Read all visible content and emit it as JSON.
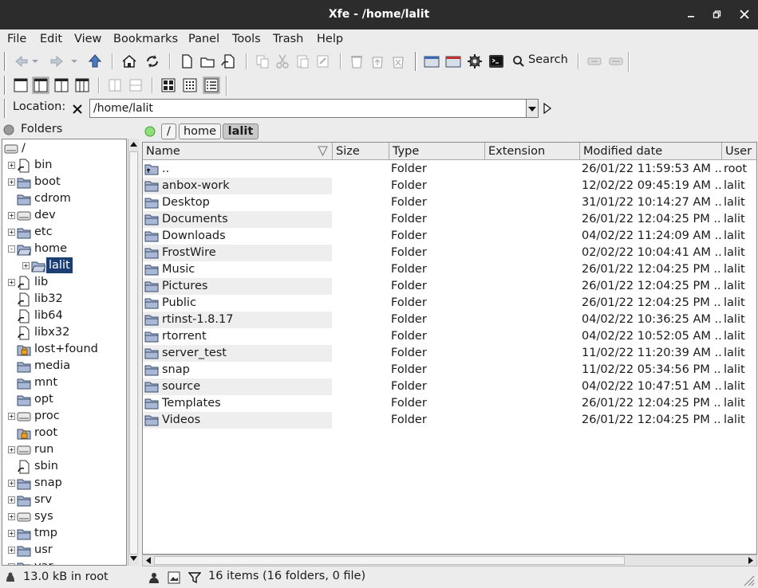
{
  "window": {
    "title": "Xfe - /home/lalit"
  },
  "menu": [
    "File",
    "Edit",
    "View",
    "Bookmarks",
    "Panel",
    "Tools",
    "Trash",
    "Help"
  ],
  "toolbar": {
    "search_label": "Search"
  },
  "location": {
    "label": "Location:",
    "value": "/home/lalit"
  },
  "folders": {
    "title": "Folders",
    "items": [
      {
        "label": "/",
        "level": 0,
        "exp": "",
        "icon": "drive"
      },
      {
        "label": "bin",
        "level": 1,
        "exp": "+",
        "icon": "link"
      },
      {
        "label": "boot",
        "level": 1,
        "exp": "+",
        "icon": "folder"
      },
      {
        "label": "cdrom",
        "level": 1,
        "exp": "",
        "icon": "folder"
      },
      {
        "label": "dev",
        "level": 1,
        "exp": "+",
        "icon": "drive"
      },
      {
        "label": "etc",
        "level": 1,
        "exp": "+",
        "icon": "folder"
      },
      {
        "label": "home",
        "level": 1,
        "exp": "-",
        "icon": "folder-open"
      },
      {
        "label": "lalit",
        "level": 2,
        "exp": "+",
        "icon": "folder-open",
        "selected": true
      },
      {
        "label": "lib",
        "level": 1,
        "exp": "+",
        "icon": "link"
      },
      {
        "label": "lib32",
        "level": 1,
        "exp": "",
        "icon": "link"
      },
      {
        "label": "lib64",
        "level": 1,
        "exp": "",
        "icon": "link"
      },
      {
        "label": "libx32",
        "level": 1,
        "exp": "",
        "icon": "link"
      },
      {
        "label": "lost+found",
        "level": 1,
        "exp": "",
        "icon": "locked"
      },
      {
        "label": "media",
        "level": 1,
        "exp": "",
        "icon": "folder"
      },
      {
        "label": "mnt",
        "level": 1,
        "exp": "",
        "icon": "folder"
      },
      {
        "label": "opt",
        "level": 1,
        "exp": "",
        "icon": "folder"
      },
      {
        "label": "proc",
        "level": 1,
        "exp": "+",
        "icon": "drive"
      },
      {
        "label": "root",
        "level": 1,
        "exp": "",
        "icon": "locked"
      },
      {
        "label": "run",
        "level": 1,
        "exp": "+",
        "icon": "drive"
      },
      {
        "label": "sbin",
        "level": 1,
        "exp": "",
        "icon": "link"
      },
      {
        "label": "snap",
        "level": 1,
        "exp": "+",
        "icon": "folder"
      },
      {
        "label": "srv",
        "level": 1,
        "exp": "+",
        "icon": "folder"
      },
      {
        "label": "sys",
        "level": 1,
        "exp": "+",
        "icon": "drive"
      },
      {
        "label": "tmp",
        "level": 1,
        "exp": "+",
        "icon": "folder"
      },
      {
        "label": "usr",
        "level": 1,
        "exp": "+",
        "icon": "folder"
      },
      {
        "label": "var",
        "level": 1,
        "exp": "+",
        "icon": "folder"
      }
    ]
  },
  "breadcrumb": [
    "/",
    "home",
    "lalit"
  ],
  "filelist": {
    "columns": [
      "Name",
      "Size",
      "Type",
      "Extension",
      "Modified date",
      "User"
    ],
    "rows": [
      {
        "name": "..",
        "size": "",
        "type": "Folder",
        "ext": "",
        "date": "26/01/22 11:59:53 AM ...",
        "user": "root",
        "up": true
      },
      {
        "name": "anbox-work",
        "size": "",
        "type": "Folder",
        "ext": "",
        "date": "12/02/22 09:45:19 AM ...",
        "user": "lalit"
      },
      {
        "name": "Desktop",
        "size": "",
        "type": "Folder",
        "ext": "",
        "date": "31/01/22 10:14:27 AM ...",
        "user": "lalit"
      },
      {
        "name": "Documents",
        "size": "",
        "type": "Folder",
        "ext": "",
        "date": "26/01/22 12:04:25 PM ...",
        "user": "lalit"
      },
      {
        "name": "Downloads",
        "size": "",
        "type": "Folder",
        "ext": "",
        "date": "04/02/22 11:24:09 AM ...",
        "user": "lalit"
      },
      {
        "name": "FrostWire",
        "size": "",
        "type": "Folder",
        "ext": "",
        "date": "02/02/22 10:04:41 AM ...",
        "user": "lalit"
      },
      {
        "name": "Music",
        "size": "",
        "type": "Folder",
        "ext": "",
        "date": "26/01/22 12:04:25 PM ...",
        "user": "lalit"
      },
      {
        "name": "Pictures",
        "size": "",
        "type": "Folder",
        "ext": "",
        "date": "26/01/22 12:04:25 PM ...",
        "user": "lalit"
      },
      {
        "name": "Public",
        "size": "",
        "type": "Folder",
        "ext": "",
        "date": "26/01/22 12:04:25 PM ...",
        "user": "lalit"
      },
      {
        "name": "rtinst-1.8.17",
        "size": "",
        "type": "Folder",
        "ext": "",
        "date": "04/02/22 10:36:25 AM ...",
        "user": "lalit"
      },
      {
        "name": "rtorrent",
        "size": "",
        "type": "Folder",
        "ext": "",
        "date": "04/02/22 10:52:05 AM ...",
        "user": "lalit"
      },
      {
        "name": "server_test",
        "size": "",
        "type": "Folder",
        "ext": "",
        "date": "11/02/22 11:20:39 AM ...",
        "user": "lalit"
      },
      {
        "name": "snap",
        "size": "",
        "type": "Folder",
        "ext": "",
        "date": "11/02/22 05:34:56 PM ...",
        "user": "lalit"
      },
      {
        "name": "source",
        "size": "",
        "type": "Folder",
        "ext": "",
        "date": "04/02/22 10:47:51 AM ...",
        "user": "lalit"
      },
      {
        "name": "Templates",
        "size": "",
        "type": "Folder",
        "ext": "",
        "date": "26/01/22 12:04:25 PM ...",
        "user": "lalit"
      },
      {
        "name": "Videos",
        "size": "",
        "type": "Folder",
        "ext": "",
        "date": "26/01/22 12:04:25 PM ...",
        "user": "lalit"
      }
    ]
  },
  "status": {
    "left": "13.0 kB in root",
    "right": "16 items (16 folders, 0 file)"
  },
  "colors": {
    "selection": "#1c3f73",
    "row_alt": "#eeeeee",
    "titlebar": "#2c2c2c",
    "folder_fill": "#a9b8d6",
    "folder_stroke": "#3a4a66"
  }
}
